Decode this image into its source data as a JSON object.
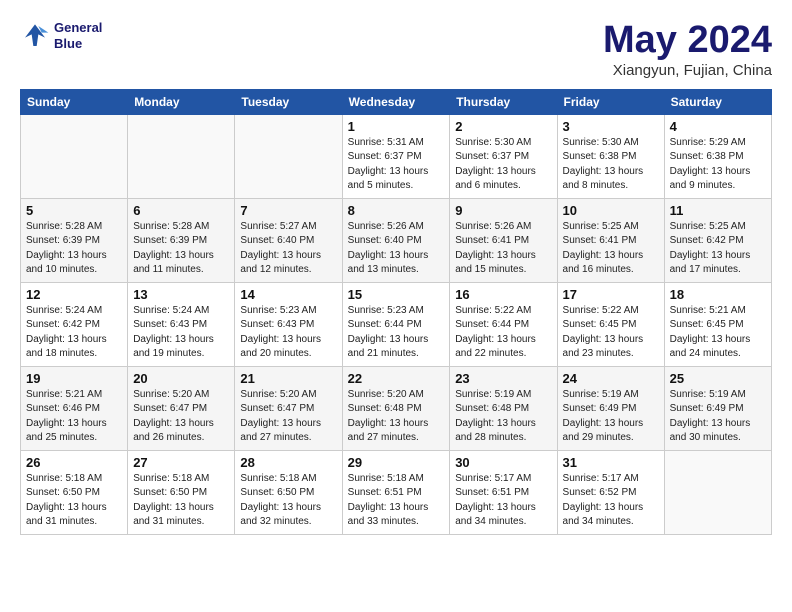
{
  "logo": {
    "line1": "General",
    "line2": "Blue"
  },
  "title": "May 2024",
  "subtitle": "Xiangyun, Fujian, China",
  "headers": [
    "Sunday",
    "Monday",
    "Tuesday",
    "Wednesday",
    "Thursday",
    "Friday",
    "Saturday"
  ],
  "weeks": [
    [
      {
        "day": "",
        "info": ""
      },
      {
        "day": "",
        "info": ""
      },
      {
        "day": "",
        "info": ""
      },
      {
        "day": "1",
        "info": "Sunrise: 5:31 AM\nSunset: 6:37 PM\nDaylight: 13 hours and 5 minutes."
      },
      {
        "day": "2",
        "info": "Sunrise: 5:30 AM\nSunset: 6:37 PM\nDaylight: 13 hours and 6 minutes."
      },
      {
        "day": "3",
        "info": "Sunrise: 5:30 AM\nSunset: 6:38 PM\nDaylight: 13 hours and 8 minutes."
      },
      {
        "day": "4",
        "info": "Sunrise: 5:29 AM\nSunset: 6:38 PM\nDaylight: 13 hours and 9 minutes."
      }
    ],
    [
      {
        "day": "5",
        "info": "Sunrise: 5:28 AM\nSunset: 6:39 PM\nDaylight: 13 hours and 10 minutes."
      },
      {
        "day": "6",
        "info": "Sunrise: 5:28 AM\nSunset: 6:39 PM\nDaylight: 13 hours and 11 minutes."
      },
      {
        "day": "7",
        "info": "Sunrise: 5:27 AM\nSunset: 6:40 PM\nDaylight: 13 hours and 12 minutes."
      },
      {
        "day": "8",
        "info": "Sunrise: 5:26 AM\nSunset: 6:40 PM\nDaylight: 13 hours and 13 minutes."
      },
      {
        "day": "9",
        "info": "Sunrise: 5:26 AM\nSunset: 6:41 PM\nDaylight: 13 hours and 15 minutes."
      },
      {
        "day": "10",
        "info": "Sunrise: 5:25 AM\nSunset: 6:41 PM\nDaylight: 13 hours and 16 minutes."
      },
      {
        "day": "11",
        "info": "Sunrise: 5:25 AM\nSunset: 6:42 PM\nDaylight: 13 hours and 17 minutes."
      }
    ],
    [
      {
        "day": "12",
        "info": "Sunrise: 5:24 AM\nSunset: 6:42 PM\nDaylight: 13 hours and 18 minutes."
      },
      {
        "day": "13",
        "info": "Sunrise: 5:24 AM\nSunset: 6:43 PM\nDaylight: 13 hours and 19 minutes."
      },
      {
        "day": "14",
        "info": "Sunrise: 5:23 AM\nSunset: 6:43 PM\nDaylight: 13 hours and 20 minutes."
      },
      {
        "day": "15",
        "info": "Sunrise: 5:23 AM\nSunset: 6:44 PM\nDaylight: 13 hours and 21 minutes."
      },
      {
        "day": "16",
        "info": "Sunrise: 5:22 AM\nSunset: 6:44 PM\nDaylight: 13 hours and 22 minutes."
      },
      {
        "day": "17",
        "info": "Sunrise: 5:22 AM\nSunset: 6:45 PM\nDaylight: 13 hours and 23 minutes."
      },
      {
        "day": "18",
        "info": "Sunrise: 5:21 AM\nSunset: 6:45 PM\nDaylight: 13 hours and 24 minutes."
      }
    ],
    [
      {
        "day": "19",
        "info": "Sunrise: 5:21 AM\nSunset: 6:46 PM\nDaylight: 13 hours and 25 minutes."
      },
      {
        "day": "20",
        "info": "Sunrise: 5:20 AM\nSunset: 6:47 PM\nDaylight: 13 hours and 26 minutes."
      },
      {
        "day": "21",
        "info": "Sunrise: 5:20 AM\nSunset: 6:47 PM\nDaylight: 13 hours and 27 minutes."
      },
      {
        "day": "22",
        "info": "Sunrise: 5:20 AM\nSunset: 6:48 PM\nDaylight: 13 hours and 27 minutes."
      },
      {
        "day": "23",
        "info": "Sunrise: 5:19 AM\nSunset: 6:48 PM\nDaylight: 13 hours and 28 minutes."
      },
      {
        "day": "24",
        "info": "Sunrise: 5:19 AM\nSunset: 6:49 PM\nDaylight: 13 hours and 29 minutes."
      },
      {
        "day": "25",
        "info": "Sunrise: 5:19 AM\nSunset: 6:49 PM\nDaylight: 13 hours and 30 minutes."
      }
    ],
    [
      {
        "day": "26",
        "info": "Sunrise: 5:18 AM\nSunset: 6:50 PM\nDaylight: 13 hours and 31 minutes."
      },
      {
        "day": "27",
        "info": "Sunrise: 5:18 AM\nSunset: 6:50 PM\nDaylight: 13 hours and 31 minutes."
      },
      {
        "day": "28",
        "info": "Sunrise: 5:18 AM\nSunset: 6:50 PM\nDaylight: 13 hours and 32 minutes."
      },
      {
        "day": "29",
        "info": "Sunrise: 5:18 AM\nSunset: 6:51 PM\nDaylight: 13 hours and 33 minutes."
      },
      {
        "day": "30",
        "info": "Sunrise: 5:17 AM\nSunset: 6:51 PM\nDaylight: 13 hours and 34 minutes."
      },
      {
        "day": "31",
        "info": "Sunrise: 5:17 AM\nSunset: 6:52 PM\nDaylight: 13 hours and 34 minutes."
      },
      {
        "day": "",
        "info": ""
      }
    ]
  ]
}
